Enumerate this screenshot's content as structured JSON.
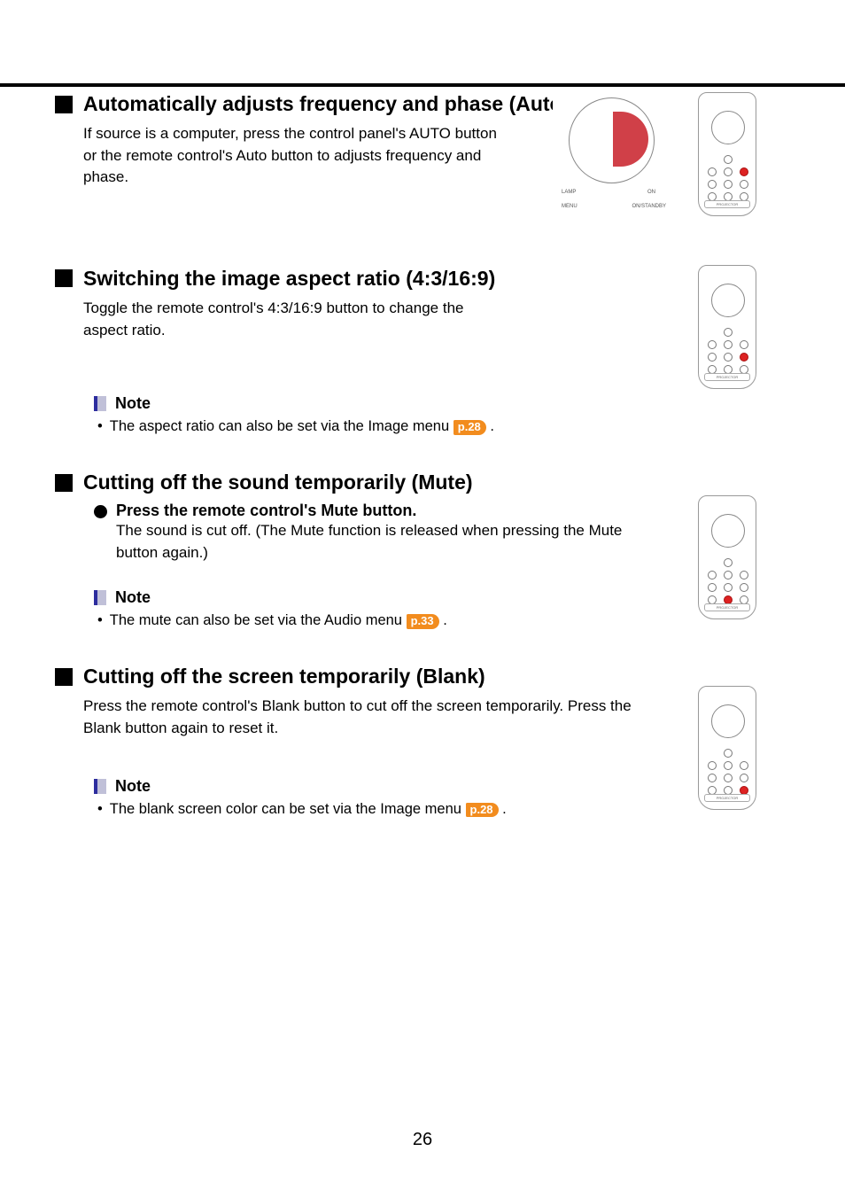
{
  "page_number": "26",
  "sections": {
    "auto": {
      "title": "Automatically adjusts frequency and phase (Auto)",
      "body": "If source is a computer, press the control panel's AUTO button or the remote control's Auto button to adjusts frequency and phase."
    },
    "aspect": {
      "title": "Switching the image aspect ratio (4:3/16:9)",
      "body": "Toggle the remote control's 4:3/16:9 button to change the aspect ratio.",
      "note_label": "Note",
      "note_bullet": "The aspect ratio can also be set via the Image menu",
      "note_ref": "p.28",
      "note_tail": "."
    },
    "mute": {
      "title": "Cutting off the sound temporarily (Mute)",
      "step_title": "Press the remote control's Mute button.",
      "step_body": "The sound is cut off. (The Mute function is released when pressing the Mute button again.)",
      "note_label": "Note",
      "note_bullet": "The mute can also be set via the Audio menu",
      "note_ref": "p.33",
      "note_tail": "."
    },
    "blank": {
      "title": "Cutting off the screen temporarily (Blank)",
      "body": "Press the remote control's Blank button to cut off the screen temporarily. Press the Blank button again to reset it.",
      "note_label": "Note",
      "note_bullet": "The blank screen color can be set via the Image menu",
      "note_ref": "p.28",
      "note_tail": "."
    }
  },
  "illustration_labels": {
    "panel_lamp": "LAMP",
    "panel_on": "ON",
    "panel_menu": "MENU",
    "panel_standby": "ON/STANDBY",
    "remote_label": "PROJECTOR"
  }
}
